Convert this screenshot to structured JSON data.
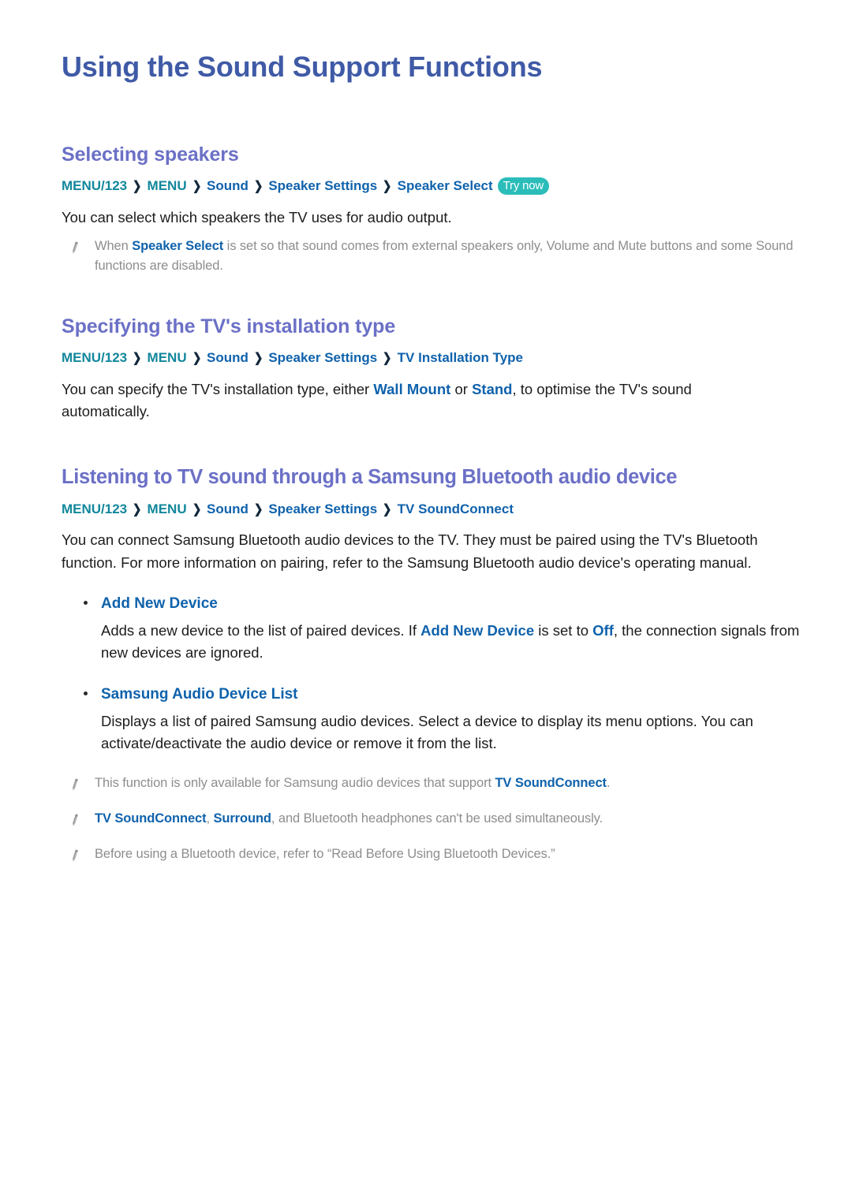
{
  "document": {
    "title": "Using the Sound Support Functions"
  },
  "sections": [
    {
      "heading": "Selecting speakers",
      "breadcrumb": {
        "items": [
          "MENU/123",
          "MENU",
          "Sound",
          "Speaker Settings",
          "Speaker Select"
        ],
        "separator": "❯",
        "badge": "Try now"
      },
      "paragraph": "You can select which speakers the TV uses for audio output.",
      "note": {
        "pre": "When ",
        "keyword": "Speaker Select",
        "post": " is set so that sound comes from external speakers only, Volume and Mute buttons and some Sound functions are disabled."
      }
    },
    {
      "heading": "Specifying the TV's installation type",
      "breadcrumb": {
        "items": [
          "MENU/123",
          "MENU",
          "Sound",
          "Speaker Settings",
          "TV Installation Type"
        ],
        "separator": "❯"
      },
      "paragraph_parts": {
        "p1": "You can specify the TV's installation type, either ",
        "kw1": "Wall Mount",
        "p2": " or ",
        "kw2": "Stand",
        "p3": ", to optimise the TV's sound automatically."
      }
    },
    {
      "heading": "Listening to TV sound through a Samsung Bluetooth audio device",
      "breadcrumb": {
        "items": [
          "MENU/123",
          "MENU",
          "Sound",
          "Speaker Settings",
          "TV SoundConnect"
        ],
        "separator": "❯"
      },
      "paragraph": "You can connect Samsung Bluetooth audio devices to the TV. They must be paired using the TV's Bluetooth function. For more information on pairing, refer to the Samsung Bluetooth audio device's operating manual.",
      "bullets": [
        {
          "label": "Add New Device",
          "desc_parts": {
            "p1": "Adds a new device to the list of paired devices. If ",
            "kw1": "Add New Device",
            "p2": " is set to ",
            "kw2": "Off",
            "p3": ", the connection signals from new devices are ignored."
          }
        },
        {
          "label": "Samsung Audio Device List",
          "desc_parts": {
            "p1": "Displays a list of paired Samsung audio devices. Select a device to display its menu options. You can activate/deactivate the audio device or remove it from the list.",
            "kw1": "",
            "p2": "",
            "kw2": "",
            "p3": ""
          }
        }
      ],
      "notes": [
        {
          "pre": "This function is only available for Samsung audio devices that support ",
          "keyword": "TV SoundConnect",
          "post": "."
        },
        {
          "pre": "",
          "keyword": "TV SoundConnect",
          "mid": ", ",
          "keyword2": "Surround",
          "post": ", and Bluetooth headphones can't be used simultaneously."
        },
        {
          "pre": "Before using a Bluetooth device, refer to “Read Before Using Bluetooth Devices.”",
          "keyword": "",
          "post": ""
        }
      ]
    }
  ],
  "colors": {
    "doc_title": "#3f5aa6",
    "section_title": "#6b70c6",
    "breadcrumb_teal": "#12879c",
    "breadcrumb_blue": "#0f62ac",
    "badge_bg": "#2bbdb9",
    "keyword_blue": "#0f62ac",
    "note_gray": "#8d8d8d",
    "body_text": "#1c1c1c"
  },
  "icons": {
    "note": "pencil-icon",
    "breadcrumb_separator": "chevron-right-icon",
    "bullet": "bullet-dot-icon"
  }
}
